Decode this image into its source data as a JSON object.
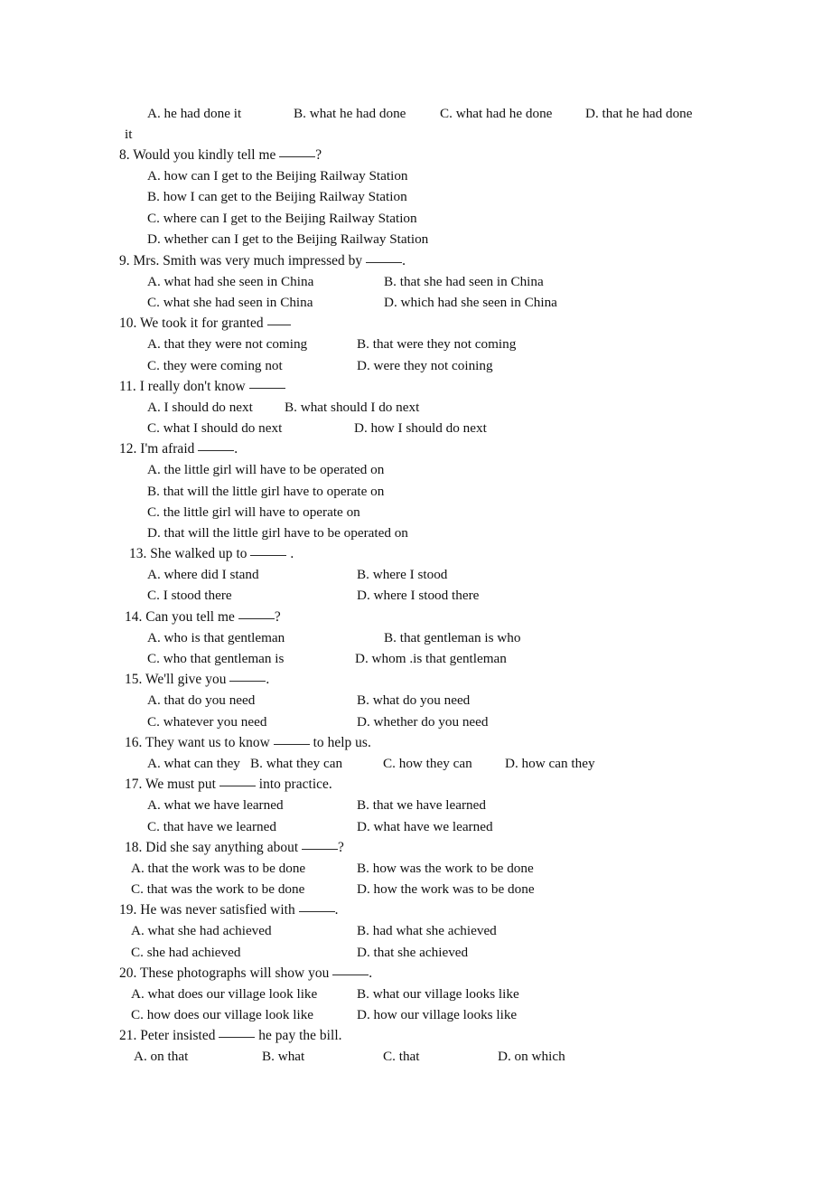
{
  "document": {
    "kind": "grammar-worksheet-scan",
    "subject": "English noun clauses multiple choice",
    "page_background": "#ffffff",
    "text_color": "#101010"
  },
  "continued_item": {
    "options": [
      "A. he had done it",
      "B. what he had done",
      "C. what had he done",
      "D. that he had done"
    ],
    "wrapped_tail": "it"
  },
  "questions": [
    {
      "number": "8.",
      "stem_before": "8. Would you kindly tell me ",
      "stem_after": "?",
      "layout": "stacked",
      "options": [
        "A. how can I get to the Beijing Railway Station",
        "B. how I can get to the Beijing Railway Station",
        "C. where can I get to the Beijing Railway Station",
        "D. whether can I get to the Beijing Railway Station"
      ]
    },
    {
      "number": "9.",
      "stem_before": "9. Mrs. Smith was very much impressed by ",
      "stem_after": ".",
      "layout": "two-column",
      "options": [
        "A. what had she seen in China",
        "B. that she had seen in China",
        "C. what she had seen in China",
        "D. which had she seen in China"
      ]
    },
    {
      "number": "10.",
      "stem_before": "10. We took it for granted ",
      "stem_after": "",
      "layout": "two-column",
      "options": [
        "A. that they were not coming",
        "B. that were they not coming",
        "C. they were coming not",
        "D. were they not coining"
      ]
    },
    {
      "number": "11.",
      "stem_before": "11. I really don't know ",
      "stem_after": "",
      "layout": "two-column",
      "options": [
        "A. I should do next",
        "B. what should I do next",
        "C. what I should do next",
        "D. how I should do next"
      ]
    },
    {
      "number": "12.",
      "stem_before": "12. I'm afraid ",
      "stem_after": ".",
      "layout": "stacked",
      "options": [
        "A. the little girl will have to be operated on",
        "B. that will the little girl have to operate on",
        "C. the little girl will have to operate on",
        "D. that will the little girl have to be operated on"
      ]
    },
    {
      "number": "13.",
      "stem_before": "13. She walked up to ",
      "stem_after": " .",
      "layout": "two-column",
      "options": [
        "A. where did I stand",
        "B. where I stood",
        "C. I stood there",
        "D. where I stood there"
      ]
    },
    {
      "number": "14.",
      "stem_before": "14. Can you tell me ",
      "stem_after": "?",
      "layout": "two-column",
      "options": [
        "A. who is that gentleman",
        "B. that gentleman is who",
        "C. who that gentleman is",
        "D. whom .is that gentleman"
      ]
    },
    {
      "number": "15.",
      "stem_before": "15. We'll give you ",
      "stem_after": ".",
      "layout": "two-column",
      "options": [
        "A. that do you need",
        "B. what do you need",
        "C. whatever you need",
        "D. whether do you need"
      ]
    },
    {
      "number": "16.",
      "stem_before": "16. They want us to know ",
      "stem_after": " to help us.",
      "layout": "four-column",
      "options": [
        "A. what can they",
        "B. what they can",
        "C. how they can",
        "D. how can they"
      ]
    },
    {
      "number": "17.",
      "stem_before": "17. We must put ",
      "stem_after": " into practice.",
      "layout": "two-column",
      "options": [
        "A. what we have learned",
        "B. that we have learned",
        "C. that have we learned",
        "D. what have we learned"
      ]
    },
    {
      "number": "18.",
      "stem_before": "18. Did she say anything about ",
      "stem_after": "?",
      "layout": "two-column",
      "options": [
        "A. that the work was to be done",
        "B. how was the work to be done",
        "C. that was the work to be done",
        "D. how the work was to be done"
      ]
    },
    {
      "number": "19.",
      "stem_before": "19. He was never satisfied with ",
      "stem_after": ".",
      "layout": "two-column",
      "options": [
        "A. what she had achieved",
        "B. had what she achieved",
        "C. she had achieved",
        "D. that she achieved"
      ]
    },
    {
      "number": "20.",
      "stem_before": "20. These photographs will show you ",
      "stem_after": ".",
      "layout": "two-column",
      "options": [
        "A. what does our village look like",
        "B. what our village looks like",
        "C. how does our village look like",
        "D. how our village looks like"
      ]
    },
    {
      "number": "21.",
      "stem_before": "21. Peter insisted ",
      "stem_after": " he pay the bill.",
      "layout": "four-column",
      "options": [
        "A. on that",
        "B. what",
        "C. that",
        "D. on which"
      ]
    }
  ]
}
